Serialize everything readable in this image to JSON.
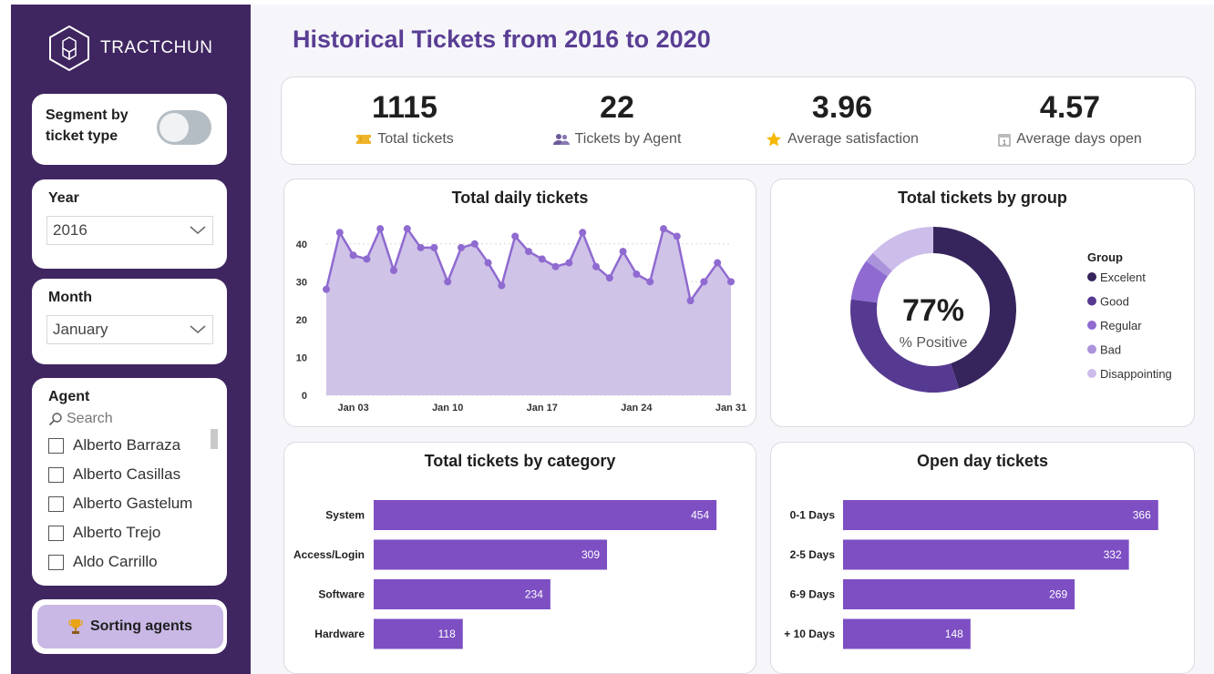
{
  "brand": {
    "name": "TRACTCHUN"
  },
  "page": {
    "title": "Historical Tickets from 2016 to 2020"
  },
  "sidebar": {
    "segment": {
      "label": "Segment by ticket type",
      "state": "off"
    },
    "year": {
      "title": "Year",
      "value": "2016"
    },
    "month": {
      "title": "Month",
      "value": "January"
    },
    "agent": {
      "title": "Agent",
      "search_placeholder": "Search",
      "items": [
        "Alberto Barraza",
        "Alberto Casillas",
        "Alberto Gastelum",
        "Alberto Trejo",
        "Aldo Carrillo"
      ]
    },
    "sorting_button": {
      "label": "Sorting agents"
    }
  },
  "kpis": [
    {
      "value": "1115",
      "label": "Total tickets",
      "icon": "ticket-icon"
    },
    {
      "value": "22",
      "label": "Tickets by Agent",
      "icon": "people-icon"
    },
    {
      "value": "3.96",
      "label": "Average satisfaction",
      "icon": "star-icon"
    },
    {
      "value": "4.57",
      "label": "Average days open",
      "icon": "calendar-icon"
    }
  ],
  "colors": {
    "accent": "#5a3e94",
    "bar": "#7d4fc3",
    "area": "#cfc3e8",
    "line": "#8f6ad0",
    "sidebar": "#3f2660"
  },
  "chart_data": [
    {
      "type": "area",
      "title": "Total daily tickets",
      "x": [
        1,
        2,
        3,
        4,
        5,
        6,
        7,
        8,
        9,
        10,
        11,
        12,
        13,
        14,
        15,
        16,
        17,
        18,
        19,
        20,
        21,
        22,
        23,
        24,
        25,
        26,
        27,
        28,
        29,
        30,
        31
      ],
      "values": [
        28,
        43,
        37,
        36,
        44,
        33,
        44,
        39,
        39,
        30,
        39,
        40,
        35,
        29,
        42,
        38,
        36,
        34,
        35,
        43,
        34,
        31,
        38,
        32,
        30,
        44,
        42,
        25,
        30,
        35,
        30
      ],
      "x_ticks": [
        "Jan 03",
        "Jan 10",
        "Jan 17",
        "Jan 24",
        "Jan 31"
      ],
      "y_ticks": [
        "0",
        "10",
        "20",
        "30",
        "40"
      ],
      "ylim": [
        0,
        45
      ]
    },
    {
      "type": "pie",
      "title": "Total tickets by group",
      "center_value": "77%",
      "center_label": "% Positive",
      "legend_title": "Group",
      "categories": [
        "Excelent",
        "Good",
        "Regular",
        "Bad",
        "Disappointing"
      ],
      "values": [
        45,
        32,
        8,
        2,
        13
      ],
      "colors": [
        "#36245c",
        "#563a91",
        "#8f6ad0",
        "#ab93dc",
        "#cdbdea"
      ]
    },
    {
      "type": "bar",
      "title": "Total tickets by category",
      "categories": [
        "System",
        "Access/Login",
        "Software",
        "Hardware"
      ],
      "values": [
        454,
        309,
        234,
        118
      ],
      "xlim": [
        0,
        490
      ]
    },
    {
      "type": "bar",
      "title": "Open day tickets",
      "categories": [
        "0-1 Days",
        "2-5 Days",
        "6-9 Days",
        "+ 10 Days"
      ],
      "values": [
        366,
        332,
        269,
        148
      ],
      "xlim": [
        0,
        380
      ]
    }
  ]
}
